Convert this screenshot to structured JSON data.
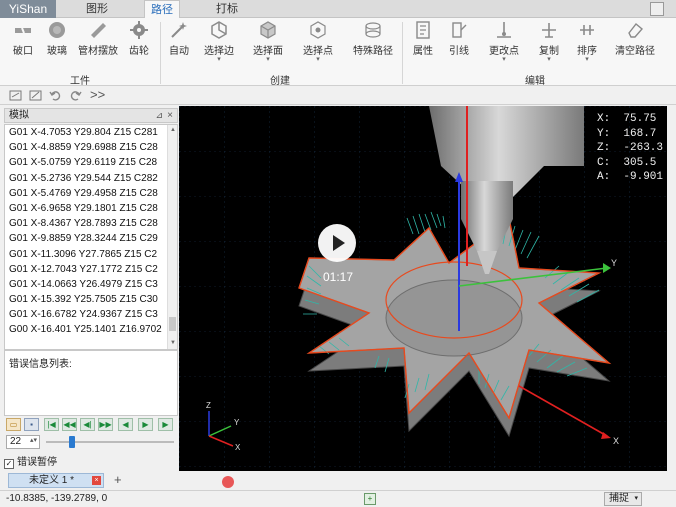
{
  "app": {
    "logo": "YiShan"
  },
  "tabs": [
    {
      "label": "图形",
      "active": false
    },
    {
      "label": "路径",
      "active": true
    },
    {
      "label": "打标",
      "active": false
    }
  ],
  "ribbon": {
    "groups": [
      {
        "label": "工件",
        "buttons": [
          "破口",
          "玻璃",
          "管材摆放",
          "齿轮"
        ]
      },
      {
        "label": "创建",
        "buttons": [
          "自动",
          "选择边",
          "选择面",
          "选择点",
          "特殊路径"
        ]
      },
      {
        "label": "编辑",
        "buttons": [
          "属性",
          "引线",
          "更改点",
          "复制",
          "排序",
          "清空路径"
        ]
      }
    ]
  },
  "quick_toolbar": {
    "overflow_label": ">>"
  },
  "sim_panel": {
    "title": "模拟",
    "gcode_lines": [
      "G01 X-4.7053 Y29.804 Z15 C281",
      "G01 X-4.8859 Y29.6988 Z15 C28",
      "G01 X-5.0759 Y29.6119 Z15 C28",
      "G01 X-5.2736 Y29.544 Z15 C282",
      "G01 X-5.4769 Y29.4958 Z15 C28",
      "G01 X-6.9658 Y29.1801 Z15 C28",
      "G01 X-8.4367 Y28.7893 Z15 C28",
      "G01 X-9.8859 Y28.3244 Z15 C29",
      "G01 X-11.3096 Y27.7865 Z15 C2",
      "G01 X-12.7043 Y27.1772 Z15 C2",
      "G01 X-14.0663 Y26.4979 Z15 C3",
      "G01 X-15.392 Y25.7505 Z15 C30",
      "G01 X-16.6782 Y24.9367 Z15 C3",
      "G00 X-16.401 Y25.1401 Z16.9702"
    ],
    "error_list_label": "错误信息列表:",
    "speed_value": "22",
    "speed_fraction": 0.2,
    "pause_on_error_label": "错误暂停",
    "pause_on_error_checked": true
  },
  "viewport": {
    "readout": {
      "x": "X:  75.75",
      "y": "Y:  168.7",
      "z": "Z:  -263.3",
      "c": "C:  305.5",
      "a": "A:  -9.901"
    },
    "video_time": "01:17",
    "axis_labels": {
      "x": "X",
      "y": "Y",
      "z": "Z"
    }
  },
  "document_tab": {
    "label": "未定义 1 *"
  },
  "status": {
    "coords": "-10.8385, -139.2789, 0",
    "snap_label": "捕捉"
  },
  "colors": {
    "accent": "#2a6ebb",
    "toolpath": "#e84a1e",
    "normals": "#2fb7a8",
    "x_axis": "#e02020",
    "y_axis": "#3cc23c",
    "z_axis": "#2a3ae0"
  }
}
